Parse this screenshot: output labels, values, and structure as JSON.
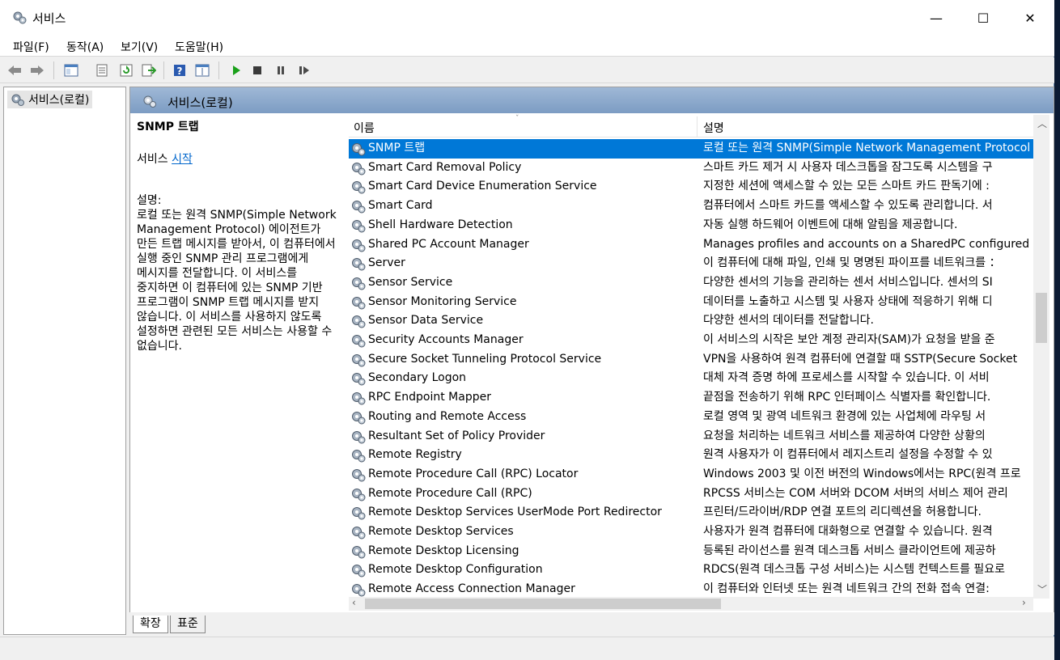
{
  "window": {
    "title": "서비스",
    "min_glyph": "—",
    "max_glyph": "☐",
    "close_glyph": "✕"
  },
  "menu": [
    "파일(F)",
    "동작(A)",
    "보기(V)",
    "도움말(H)"
  ],
  "toolbar_icons": [
    "back-icon",
    "forward-icon",
    "show-hide-tree-icon",
    "properties-icon",
    "refresh-icon",
    "export-list-icon",
    "help-icon",
    "extended-view-icon",
    "start-service-icon",
    "stop-service-icon",
    "pause-service-icon",
    "resume-service-icon"
  ],
  "tree": {
    "root_label": "서비스(로컬)"
  },
  "pane_header": {
    "title": "서비스(로컬)"
  },
  "detail": {
    "title": "SNMP 트랩",
    "service_prefix": "서비스",
    "start_link": "시작",
    "desc_label": "설명:",
    "desc_body": "로컬 또는 원격 SNMP(Simple Network Management Protocol) 에이전트가 만든 트랩 메시지를 받아서, 이 컴퓨터에서 실행 중인 SNMP 관리 프로그램에게 메시지를 전달합니다. 이 서비스를 중지하면 이 컴퓨터에 있는 SNMP 기반 프로그램이 SNMP 트랩 메시지를 받지 않습니다. 이 서비스를 사용하지 않도록 설정하면 관련된 모든 서비스는 사용할 수 없습니다."
  },
  "columns": {
    "name": "이름",
    "description": "설명"
  },
  "services": [
    {
      "name": "SNMP 트랩",
      "desc": "로컬 또는 원격 SNMP(Simple Network Management Protocol",
      "selected": true
    },
    {
      "name": "Smart Card Removal Policy",
      "desc": "스마트 카드 제거 시 사용자 데스크톱을 잠그도록 시스템을 구"
    },
    {
      "name": "Smart Card Device Enumeration Service",
      "desc": "지정한 세션에 액세스할 수 있는 모든 스마트 카드 판독기에 :"
    },
    {
      "name": "Smart Card",
      "desc": "컴퓨터에서 스마트 카드를 액세스할 수 있도록 관리합니다. 서"
    },
    {
      "name": "Shell Hardware Detection",
      "desc": "자동 실행 하드웨어 이벤트에 대해 알림을 제공합니다."
    },
    {
      "name": "Shared PC Account Manager",
      "desc": "Manages profiles and accounts on a SharedPC configured dev"
    },
    {
      "name": "Server",
      "desc": "이 컴퓨터에 대해 파일, 인쇄 및 명명된 파이프를 네트워크를 ："
    },
    {
      "name": "Sensor Service",
      "desc": "다양한 센서의 기능을 관리하는 센서 서비스입니다. 센서의 SI"
    },
    {
      "name": "Sensor Monitoring Service",
      "desc": "데이터를 노출하고 시스템 및 사용자 상태에 적응하기 위해 디"
    },
    {
      "name": "Sensor Data Service",
      "desc": "다양한 센서의 데이터를 전달합니다."
    },
    {
      "name": "Security Accounts Manager",
      "desc": "이 서비스의 시작은 보안 계정 관리자(SAM)가 요청을 받을 준"
    },
    {
      "name": "Secure Socket Tunneling Protocol Service",
      "desc": "VPN을 사용하여 원격 컴퓨터에 연결할 때 SSTP(Secure Socket"
    },
    {
      "name": "Secondary Logon",
      "desc": "대체 자격 증명 하에 프로세스를 시작할 수 있습니다. 이 서비"
    },
    {
      "name": "RPC Endpoint Mapper",
      "desc": "끝점을 전송하기 위해 RPC 인터페이스 식별자를 확인합니다."
    },
    {
      "name": "Routing and Remote Access",
      "desc": "로컬 영역 및 광역 네트워크 환경에 있는 사업체에 라우팅 서"
    },
    {
      "name": "Resultant Set of Policy Provider",
      "desc": "요청을 처리하는 네트워크 서비스를 제공하여 다양한 상황의"
    },
    {
      "name": "Remote Registry",
      "desc": "원격 사용자가 이 컴퓨터에서 레지스트리 설정을 수정할 수 있"
    },
    {
      "name": "Remote Procedure Call (RPC) Locator",
      "desc": "Windows 2003 및 이전 버전의 Windows에서는 RPC(원격 프로"
    },
    {
      "name": "Remote Procedure Call (RPC)",
      "desc": "RPCSS 서비스는 COM 서버와 DCOM 서버의 서비스 제어 관리"
    },
    {
      "name": "Remote Desktop Services UserMode Port Redirector",
      "desc": "프린터/드라이버/RDP 연결 포트의 리디렉션을 허용합니다."
    },
    {
      "name": "Remote Desktop Services",
      "desc": "사용자가 원격 컴퓨터에 대화형으로 연결할 수 있습니다. 원격"
    },
    {
      "name": "Remote Desktop Licensing",
      "desc": "등록된 라이선스를 원격 데스크톱 서비스 클라이언트에 제공하"
    },
    {
      "name": "Remote Desktop Configuration",
      "desc": "RDCS(원격 데스크톱 구성 서비스)는 시스템 컨텍스트를 필요로"
    },
    {
      "name": "Remote Access Connection Manager",
      "desc": "이 컴퓨터와 인터넷 또는 원격 네트워크 간의 전화 접속 연결:"
    }
  ],
  "tabs": [
    "확장",
    "표준"
  ],
  "colors": {
    "selection": "#0078d7",
    "pane_header": "#8aa8cc",
    "link": "#0066cc"
  }
}
